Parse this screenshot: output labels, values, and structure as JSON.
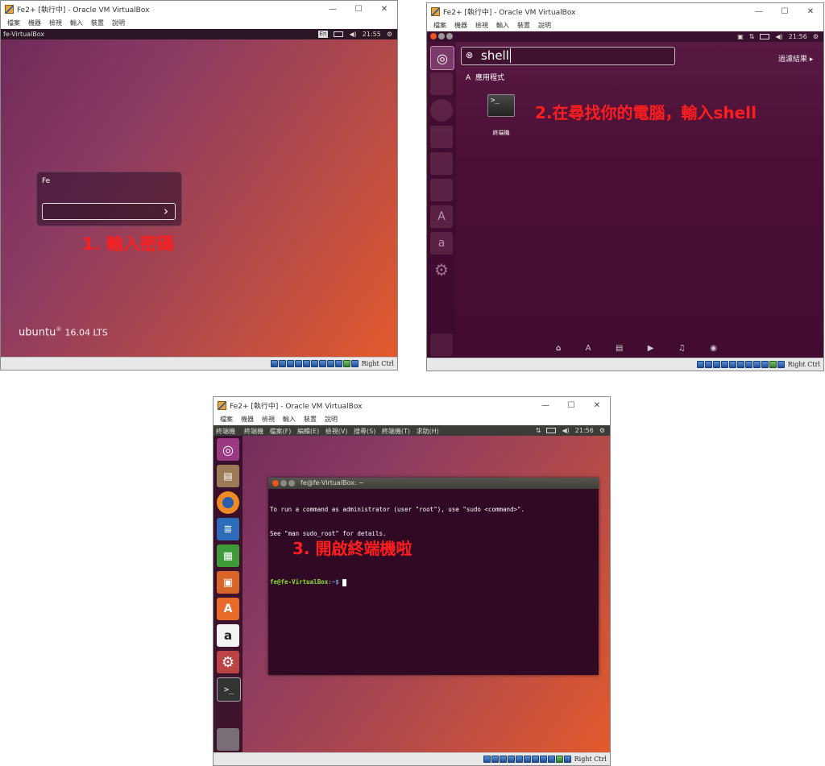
{
  "window_title": "Fe2+ [執行中] - Oracle VM VirtualBox",
  "menu_items": [
    "檔案",
    "機器",
    "檢視",
    "輸入",
    "裝置",
    "說明"
  ],
  "host_key": "Right Ctrl",
  "panel1": {
    "top_left": "fe-VirtualBox",
    "lang": "En",
    "clock": "21:55",
    "user_name": "Fe",
    "password_value": "",
    "branding": "ubuntu",
    "version": "16.04 LTS",
    "annotation": "1. 輸入密碼"
  },
  "panel2": {
    "clock": "21:56",
    "search_query": "shell",
    "filter_label": "過濾結果 ▸",
    "section_label": "應用程式",
    "result_label": "終端機",
    "annotation": "2.在尋找你的電腦，輸入shell"
  },
  "panel3": {
    "top_app": "終端機",
    "app_menu": [
      "終端機",
      "檔案(F)",
      "編輯(E)",
      "檢視(V)",
      "搜尋(S)",
      "終端機(T)",
      "求助(H)"
    ],
    "clock": "21:56",
    "terminal_title": "fe@fe-VirtualBox: ~",
    "line1": "To run a command as administrator (user \"root\"), use \"sudo <command>\".",
    "line2": "See \"man sudo_root\" for details.",
    "prompt_user": "fe@fe-VirtualBox",
    "prompt_path": ":~$",
    "annotation": "3. 開啟終端機啦"
  },
  "colors": {
    "annotation": "#ff1e1e",
    "ubuntu_panel": "#3c3b37",
    "dash_bg": "#4a0f35",
    "terminal_bg": "#300a24",
    "prompt_green": "#8ae234"
  },
  "icons": [
    "ubuntu-logo-icon",
    "search-icon",
    "terminal-icon",
    "home-icon",
    "apps-icon",
    "files-icon",
    "video-icon",
    "music-icon",
    "photo-icon",
    "firefox-icon",
    "writer-icon",
    "calc-icon",
    "impress-icon",
    "software-center-icon",
    "amazon-icon",
    "settings-icon",
    "trash-icon",
    "battery-icon",
    "volume-icon",
    "gear-icon",
    "network-icon"
  ]
}
